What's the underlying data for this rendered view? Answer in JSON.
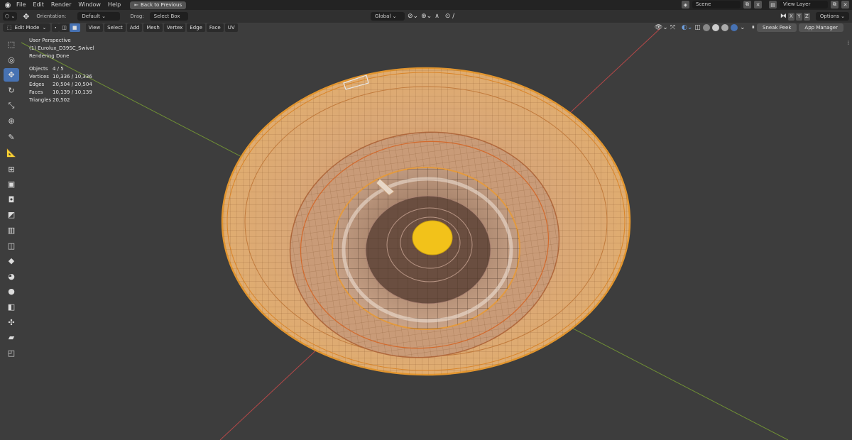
{
  "menubar": {
    "logo_icon": "blender-logo-icon",
    "items": [
      "File",
      "Edit",
      "Render",
      "Window",
      "Help"
    ],
    "back_button": "Back to Previous",
    "scene_value": "Scene",
    "view_layer_value": "View Layer"
  },
  "tool_header": {
    "orientation_label": "Orientation:",
    "orientation_value": "Default",
    "drag_label": "Drag:",
    "drag_value": "Select Box",
    "transform_orientation": "Global",
    "axis_x": "X",
    "axis_y": "Y",
    "axis_z": "Z",
    "options_label": "Options"
  },
  "viewport_header": {
    "mode": "Edit Mode",
    "menus": [
      "View",
      "Select",
      "Add",
      "Mesh",
      "Vertex",
      "Edge",
      "Face",
      "UV"
    ],
    "sneak_peek": "Sneak Peek",
    "app_manager": "App Manager"
  },
  "overlay": {
    "perspective": "User Perspective",
    "object_name": "(1) Eurolux_D39SC_Swivel",
    "render_status": "Rendering Done",
    "stats": [
      {
        "label": "Objects",
        "value": "4 / 5"
      },
      {
        "label": "Vertices",
        "value": "10,336 / 10,336"
      },
      {
        "label": "Edges",
        "value": "20,504 / 20,504"
      },
      {
        "label": "Faces",
        "value": "10,139 / 10,139"
      },
      {
        "label": "Triangles",
        "value": "20,502"
      }
    ]
  },
  "toolbar": [
    {
      "name": "select-tool-icon",
      "glyph": "⬚",
      "active": false
    },
    {
      "name": "cursor-tool-icon",
      "glyph": "◎",
      "active": false
    },
    {
      "name": "move-tool-icon",
      "glyph": "✥",
      "active": true
    },
    {
      "name": "rotate-tool-icon",
      "glyph": "↻",
      "active": false
    },
    {
      "name": "scale-tool-icon",
      "glyph": "⤡",
      "active": false
    },
    {
      "name": "transform-tool-icon",
      "glyph": "⊕",
      "active": false
    },
    {
      "name": "annotate-tool-icon",
      "glyph": "✎",
      "active": false
    },
    {
      "name": "measure-tool-icon",
      "glyph": "📐",
      "active": false
    },
    {
      "name": "add-cube-tool-icon",
      "glyph": "⊞",
      "active": false
    },
    {
      "name": "extrude-tool-icon",
      "glyph": "▣",
      "active": false
    },
    {
      "name": "inset-tool-icon",
      "glyph": "◘",
      "active": false
    },
    {
      "name": "bevel-tool-icon",
      "glyph": "◩",
      "active": false
    },
    {
      "name": "loop-cut-tool-icon",
      "glyph": "▥",
      "active": false
    },
    {
      "name": "knife-tool-icon",
      "glyph": "◫",
      "active": false
    },
    {
      "name": "poly-build-tool-icon",
      "glyph": "◆",
      "active": false
    },
    {
      "name": "spin-tool-icon",
      "glyph": "◕",
      "active": false
    },
    {
      "name": "smooth-tool-icon",
      "glyph": "●",
      "active": false
    },
    {
      "name": "edge-slide-tool-icon",
      "glyph": "◧",
      "active": false
    },
    {
      "name": "shrink-fatten-tool-icon",
      "glyph": "✣",
      "active": false
    },
    {
      "name": "shear-tool-icon",
      "glyph": "▰",
      "active": false
    },
    {
      "name": "rip-tool-icon",
      "glyph": "◰",
      "active": false
    }
  ],
  "colors": {
    "viewport_bg": "#3d3d3d",
    "mesh_orange": "#e39a3f",
    "mesh_face": "#d9b28f",
    "x_axis": "#b84a4a",
    "y_axis": "#7a9a3a",
    "active_tool": "#4772b3",
    "center_yellow": "#f2c21a"
  }
}
